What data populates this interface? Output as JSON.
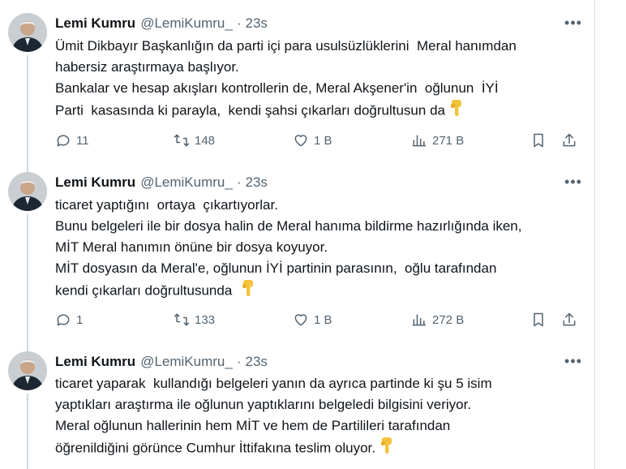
{
  "tweets": [
    {
      "name": "Lemi Kumru",
      "handle": "@LemiKumru_",
      "separator": "·",
      "time": "23s",
      "lines": [
        "Ümit Dikbayır Başkanlığın da parti içi para usulsüzlüklerini  Meral hanımdan",
        "habersiz araştırmaya başlıyor.",
        "Bankalar ve hesap akışları kontrollerin de, Meral Akşener'in  oğlunun  İYİ",
        "Parti  kasasında ki parayla,  kendi şahsi çıkarları doğrultusun da"
      ],
      "reply_count": "11",
      "repost_count": "148",
      "like_count": "1 B",
      "view_count": "271 B"
    },
    {
      "name": "Lemi Kumru",
      "handle": "@LemiKumru_",
      "separator": "·",
      "time": "23s",
      "lines": [
        "ticaret yaptığını  ortaya  çıkartıyorlar.",
        "Bunu belgeleri ile bir dosya halin de Meral hanıma bildirme hazırlığında iken,",
        "MİT Meral hanımın önüne bir dosya koyuyor.",
        "MİT dosyasın da Meral'e, oğlunun İYİ partinin parasının,  oğlu tarafından",
        "kendi çıkarları doğrultusunda"
      ],
      "reply_count": "1",
      "repost_count": "133",
      "like_count": "1 B",
      "view_count": "272 B"
    },
    {
      "name": "Lemi Kumru",
      "handle": "@LemiKumru_",
      "separator": "·",
      "time": "23s",
      "lines": [
        "ticaret yaparak  kullandığı belgeleri yanın da ayrıca partinde ki şu 5 isim",
        "yaptıkları araştırma ile oğlunun yaptıklarını belgeledi bilgisini veriyor.",
        "Meral oğlunun hallerinin hem MİT ve hem de Partilileri tarafından",
        "öğrenildiğini görünce Cumhur İttifakına teslim oluyor."
      ]
    }
  ],
  "colors": {
    "text": "#0f1419",
    "secondary": "#536471",
    "divider": "#cfd9de",
    "emoji": "#f5c33b"
  },
  "icons": [
    "more-icon",
    "reply-icon",
    "repost-icon",
    "like-icon",
    "views-icon",
    "bookmark-icon",
    "share-icon",
    "point-down-emoji"
  ]
}
